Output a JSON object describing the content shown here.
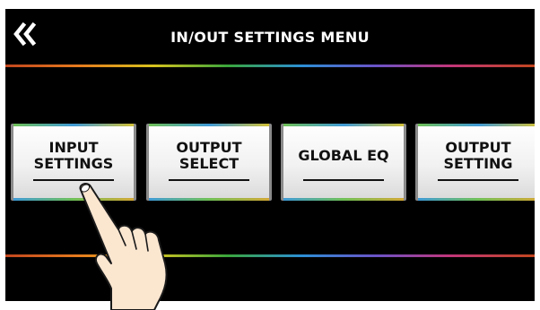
{
  "header": {
    "title": "IN/OUT SETTINGS MENU",
    "back_icon": "double-chevron-left-icon"
  },
  "menu": {
    "buttons": [
      {
        "line1": "INPUT",
        "line2": "SETTINGS"
      },
      {
        "line1": "OUTPUT",
        "line2": "SELECT"
      },
      {
        "line1": "GLOBAL EQ",
        "line2": ""
      },
      {
        "line1": "OUTPUT",
        "line2": "SETTING"
      }
    ]
  },
  "colors": {
    "background": "#000000",
    "title_text": "#ffffff",
    "button_text": "#111111"
  },
  "pointer": {
    "icon": "tapping-hand-icon"
  }
}
